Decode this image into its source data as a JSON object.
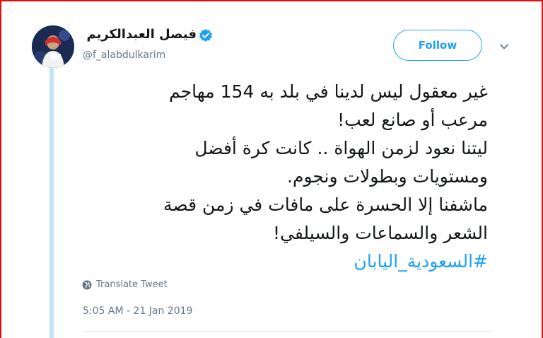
{
  "author": {
    "display_name": "فيصل العبدالكريم",
    "handle": "@f_alabdulkarim",
    "verified": true,
    "avatar_icon": "profile-photo"
  },
  "follow_button": {
    "label": "Follow"
  },
  "tweet": {
    "lines": [
      "غير معقول ليس لدينا في بلد به 154 مهاجم",
      "مرعب أو صانع لعب!",
      "ليتنا نعود لزمن الهواة .. كانت كرة أفضل",
      "ومستويات وبطولات ونجوم.",
      "ماشفنا إلا الحسرة على مافات في زمن قصة",
      "الشعر والسماعات والسيلفي!"
    ],
    "hashtag": "#السعودية_اليابان"
  },
  "translate": {
    "label": "Translate Tweet",
    "icon": "globe-icon"
  },
  "timestamp": "5:05 AM - 21 Jan 2019",
  "colors": {
    "accent": "#1da1f2",
    "text": "#14171a",
    "secondary": "#657786",
    "thread_line": "#c4e4f5",
    "frame": "#e01010"
  }
}
